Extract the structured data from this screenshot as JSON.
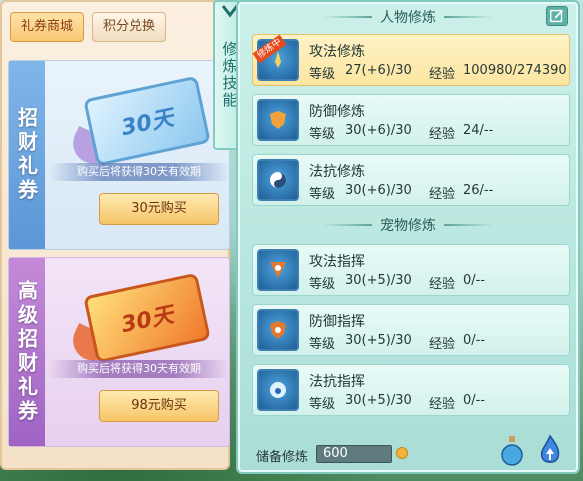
{
  "shop": {
    "tabs": [
      "礼券商城",
      "积分兑换"
    ],
    "gifts": [
      {
        "title": "招财礼券",
        "ticket_text": "30天",
        "desc": "购买后将获得30天有效期",
        "button": "30元购买"
      },
      {
        "title": "高级招财礼券",
        "ticket_text": "30天",
        "desc": "购买后将获得30天有效期",
        "button": "98元购买"
      }
    ]
  },
  "side_tab": {
    "label": "修炼技能"
  },
  "panel": {
    "sections": {
      "character": "人物修炼",
      "pet": "宠物修炼"
    },
    "rows": [
      {
        "name": "攻法修炼",
        "badge": "修炼中",
        "level_label": "等级",
        "level": "27(+6)/30",
        "exp_label": "经验",
        "exp": "100980/274390",
        "icon": "sword-icon",
        "active": true
      },
      {
        "name": "防御修炼",
        "badge": "",
        "level_label": "等级",
        "level": "30(+6)/30",
        "exp_label": "经验",
        "exp": "24/--",
        "icon": "shield-icon",
        "active": false
      },
      {
        "name": "法抗修炼",
        "badge": "",
        "level_label": "等级",
        "level": "30(+6)/30",
        "exp_label": "经验",
        "exp": "26/--",
        "icon": "yin-yang-icon",
        "active": false
      },
      {
        "name": "攻法指挥",
        "badge": "",
        "level_label": "等级",
        "level": "30(+5)/30",
        "exp_label": "经验",
        "exp": "0/--",
        "icon": "paw-flag-icon",
        "active": false
      },
      {
        "name": "防御指挥",
        "badge": "",
        "level_label": "等级",
        "level": "30(+5)/30",
        "exp_label": "经验",
        "exp": "0/--",
        "icon": "paw-shield-icon",
        "active": false
      },
      {
        "name": "法抗指挥",
        "badge": "",
        "level_label": "等级",
        "level": "30(+5)/30",
        "exp_label": "经验",
        "exp": "0/--",
        "icon": "paw-orb-icon",
        "active": false
      }
    ],
    "reserve": {
      "label": "储备修炼",
      "value": "600"
    }
  },
  "colors": {
    "accent": "#7fc9bd",
    "active_row": "#fbe5a0",
    "badge": "#e84a1c"
  }
}
